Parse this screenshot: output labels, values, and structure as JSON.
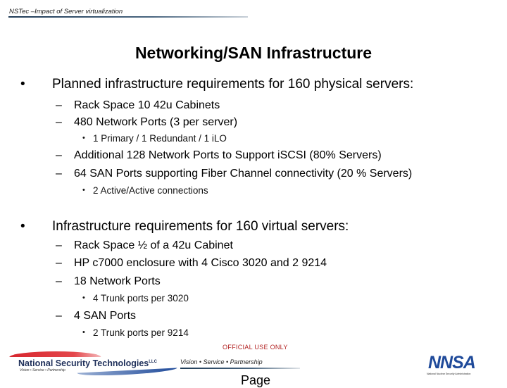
{
  "header": {
    "text": "NSTec –Impact of Server virtualization"
  },
  "title": "Networking/SAN Infrastructure",
  "sections": [
    {
      "bullet": "•",
      "text": "Planned infrastructure requirements for 160 physical servers:",
      "items": [
        {
          "dash": "–",
          "text": "Rack Space 10 42u Cabinets",
          "subs": []
        },
        {
          "dash": "–",
          "text": "480 Network Ports  (3 per server)",
          "subs": [
            "1 Primary / 1 Redundant / 1 iLO"
          ]
        },
        {
          "dash": "–",
          "text": "Additional 128 Network Ports to Support iSCSI (80% Servers)",
          "subs": []
        },
        {
          "dash": "–",
          "text": "64 SAN Ports supporting Fiber Channel connectivity  (20 % Servers)",
          "subs": [
            "2 Active/Active connections"
          ]
        }
      ]
    },
    {
      "bullet": "•",
      "text": "Infrastructure requirements for 160 virtual servers:",
      "items": [
        {
          "dash": "–",
          "text": "Rack Space ½ of a 42u Cabinet",
          "subs": []
        },
        {
          "dash": "–",
          "text": "HP c7000 enclosure with 4 Cisco 3020 and 2 9214",
          "subs": []
        },
        {
          "dash": "–",
          "text": "18 Network Ports",
          "subs": [
            "4 Trunk ports per 3020"
          ]
        },
        {
          "dash": "–",
          "text": "4 SAN Ports",
          "subs": [
            "2 Trunk ports per 9214"
          ]
        }
      ]
    }
  ],
  "sub_bullet": "•",
  "footer": {
    "classification": "OFFICIAL USE ONLY",
    "motto": "Vision • Service • Partnership",
    "page_label": "Page",
    "nstec_logo": {
      "name": "National Security Technologies",
      "llc": "LLC",
      "tagline": "Vision • Service • Partnership"
    },
    "nnsa_logo": {
      "mark": "NNSA",
      "caption": "National Nuclear Security Administration"
    }
  },
  "colors": {
    "classification": "#b22222",
    "nstec_red": "#d7262e",
    "nstec_blue": "#1e2f5a",
    "nnsa_blue": "#1f4a9a"
  }
}
